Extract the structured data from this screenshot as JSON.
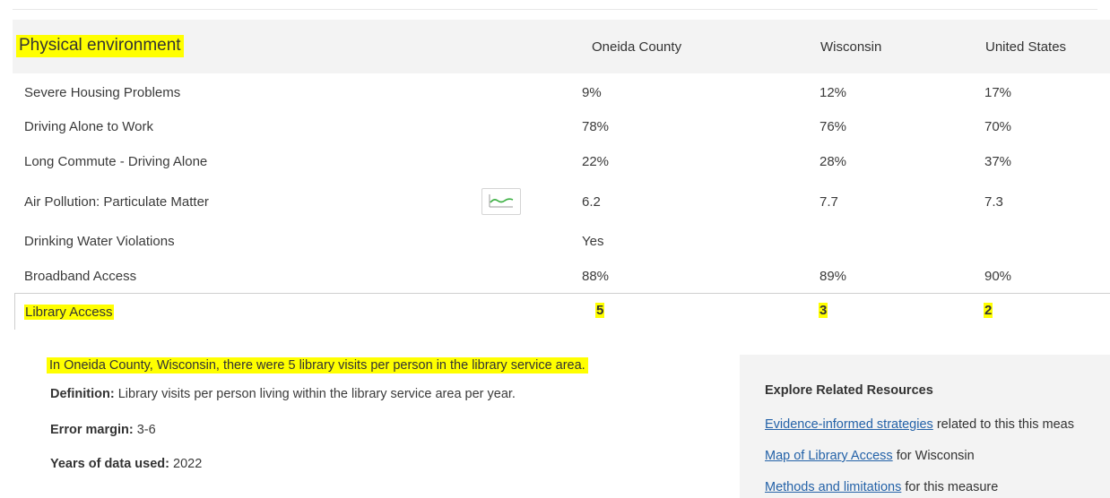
{
  "section": {
    "title": "Physical environment",
    "columns": [
      "Oneida County",
      "Wisconsin",
      "United States"
    ]
  },
  "rows": [
    {
      "label": "Severe Housing Problems",
      "county": "9%",
      "state": "12%",
      "us": "17%"
    },
    {
      "label": "Driving Alone to Work",
      "county": "78%",
      "state": "76%",
      "us": "70%"
    },
    {
      "label": "Long Commute - Driving Alone",
      "county": "22%",
      "state": "28%",
      "us": "37%"
    },
    {
      "label": "Air Pollution: Particulate Matter",
      "county": "6.2",
      "state": "7.7",
      "us": "7.3"
    },
    {
      "label": "Drinking Water Violations",
      "county": "Yes",
      "state": "",
      "us": ""
    },
    {
      "label": "Broadband Access",
      "county": "88%",
      "state": "89%",
      "us": "90%"
    }
  ],
  "library": {
    "label": "Library Access",
    "county": "5",
    "state": "3",
    "us": "2"
  },
  "trend_icon": "trend-line-icon",
  "details": {
    "summary": "In Oneida County, Wisconsin, there were 5 library visits per person in the library service area.",
    "definition_label": "Definition:",
    "definition": "Library visits per person living within the library service area per year.",
    "error_label": "Error margin:",
    "error": "3-6",
    "years_label": "Years of data used:",
    "years": "2022"
  },
  "resources": {
    "title": "Explore Related Resources",
    "link1": "Evidence-informed strategies",
    "text1": "related to this this meas",
    "link2": "Map of Library Access",
    "text2": "for Wisconsin",
    "link3": "Methods and limitations",
    "text3": "for this measure"
  },
  "colors": {
    "highlight": "#ffff00",
    "link": "#2462a8",
    "trend": "#3cb043"
  }
}
